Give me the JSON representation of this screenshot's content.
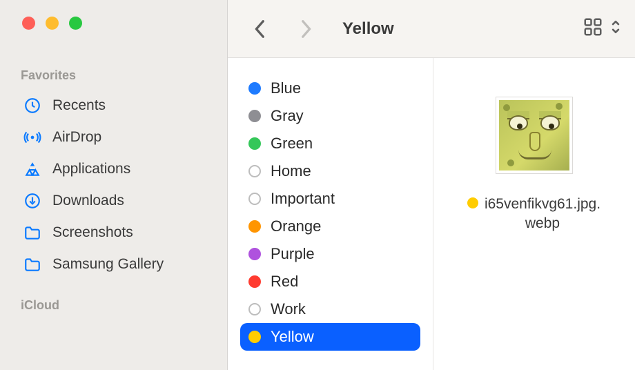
{
  "window": {
    "title": "Yellow"
  },
  "sidebar": {
    "sections": {
      "favorites_label": "Favorites",
      "icloud_label": "iCloud"
    },
    "favorites": [
      {
        "label": "Recents",
        "icon": "clock"
      },
      {
        "label": "AirDrop",
        "icon": "airdrop"
      },
      {
        "label": "Applications",
        "icon": "apps"
      },
      {
        "label": "Downloads",
        "icon": "download"
      },
      {
        "label": "Screenshots",
        "icon": "folder"
      },
      {
        "label": "Samsung Gallery",
        "icon": "folder"
      }
    ]
  },
  "tags": [
    {
      "name": "Blue",
      "color": "#1e7bff",
      "filled": true,
      "selected": false
    },
    {
      "name": "Gray",
      "color": "#8e8e93",
      "filled": true,
      "selected": false
    },
    {
      "name": "Green",
      "color": "#34c759",
      "filled": true,
      "selected": false
    },
    {
      "name": "Home",
      "color": "#bdbdbd",
      "filled": false,
      "selected": false
    },
    {
      "name": "Important",
      "color": "#bdbdbd",
      "filled": false,
      "selected": false
    },
    {
      "name": "Orange",
      "color": "#ff9500",
      "filled": true,
      "selected": false
    },
    {
      "name": "Purple",
      "color": "#af52de",
      "filled": true,
      "selected": false
    },
    {
      "name": "Red",
      "color": "#ff3b30",
      "filled": true,
      "selected": false
    },
    {
      "name": "Work",
      "color": "#bdbdbd",
      "filled": false,
      "selected": false
    },
    {
      "name": "Yellow",
      "color": "#ffcc00",
      "filled": true,
      "selected": true
    }
  ],
  "file": {
    "name": "i65venfikvg61.jpg.webp",
    "tag_color": "#ffcc00"
  },
  "colors": {
    "accent": "#0a60ff",
    "sidebar_icon": "#0a7aff"
  }
}
